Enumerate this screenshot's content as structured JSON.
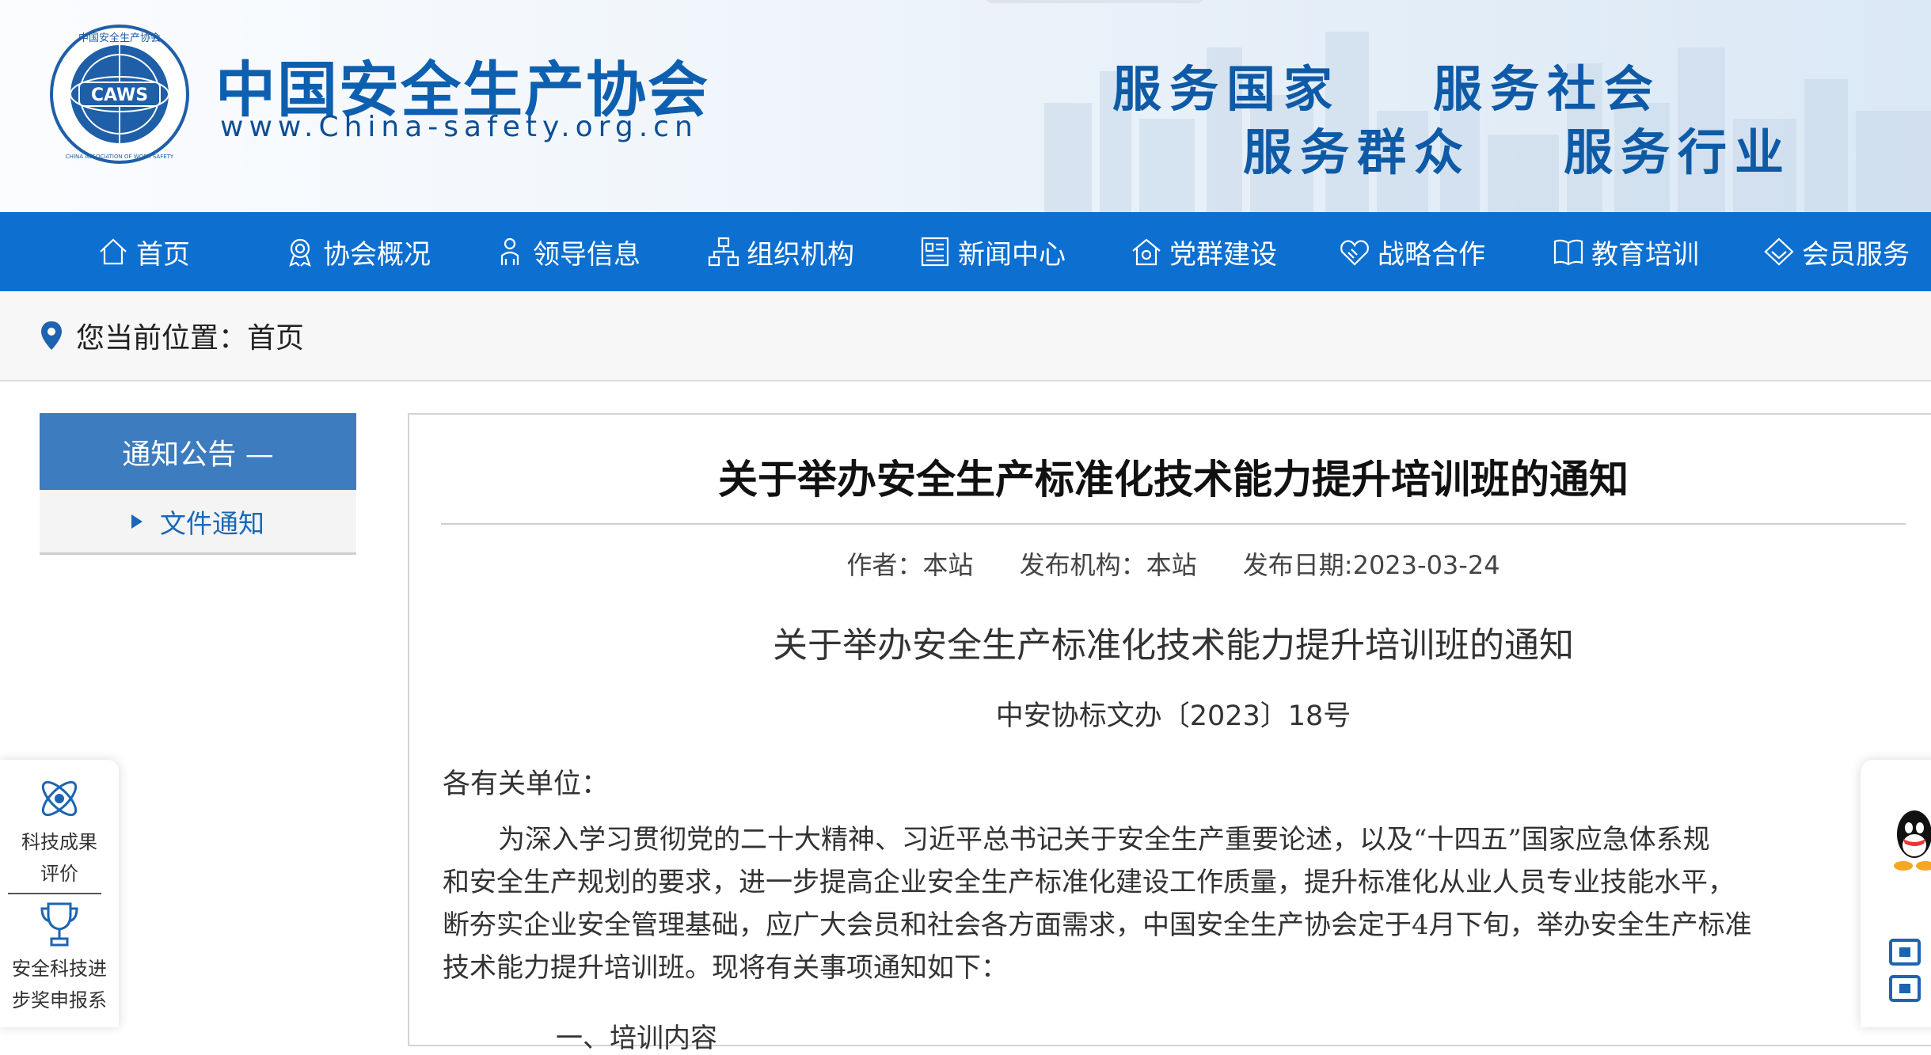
{
  "header": {
    "site_title": "中国安全生产协会",
    "site_url": "www.China-safety.org.cn",
    "logo_text": "CAWS",
    "logo_ring_top": "中国安全生产协会",
    "logo_ring_bottom": "CHINA ASSOCIATION OF WORK SAFETY",
    "slogans": [
      "服务国家",
      "服务社会",
      "服务群众",
      "服务行业"
    ]
  },
  "nav": {
    "items": [
      {
        "label": "首页",
        "icon": "home-icon"
      },
      {
        "label": "协会概况",
        "icon": "award-icon"
      },
      {
        "label": "领导信息",
        "icon": "people-icon"
      },
      {
        "label": "组织机构",
        "icon": "org-chart-icon"
      },
      {
        "label": "新闻中心",
        "icon": "newspaper-icon"
      },
      {
        "label": "党群建设",
        "icon": "building-icon"
      },
      {
        "label": "战略合作",
        "icon": "handshake-icon"
      },
      {
        "label": "教育培训",
        "icon": "book-icon"
      },
      {
        "label": "会员服务",
        "icon": "diamond-icon"
      }
    ]
  },
  "breadcrumb": {
    "prefix": "您当前位置：",
    "current": "首页",
    "icon": "location-pin-icon"
  },
  "sidebar": {
    "heading": "通知公告 —",
    "items": [
      {
        "label": "文件通知"
      }
    ]
  },
  "floating_left": {
    "items": [
      {
        "label_line1": "科技成果",
        "label_line2": "评价",
        "icon": "atom-icon"
      },
      {
        "label_line1": "安全科技进",
        "label_line2": "步奖申报系",
        "icon": "trophy-icon"
      }
    ]
  },
  "floating_right": {
    "items": [
      {
        "icon": "qq-icon"
      },
      {
        "icon": "qr-code-icon"
      }
    ]
  },
  "article": {
    "title": "关于举办安全生产标准化技术能力提升培训班的通知",
    "meta": {
      "author": "作者：本站",
      "publisher": "发布机构：本站",
      "date": "发布日期:2023-03-24"
    },
    "doc_title": "关于举办安全生产标准化技术能力提升培训班的通知",
    "doc_number": "中安协标文办〔2023〕18号",
    "salutation": "各有关单位：",
    "paragraph_lines": [
      "为深入学习贯彻党的二十大精神、习近平总书记关于安全生产重要论述，以及“十四五”国家应急体系规",
      "和安全生产规划的要求，进一步提高企业安全生产标准化建设工作质量，提升标准化从业人员专业技能水平，",
      "断夯实企业安全管理基础，应广大会员和社会各方面需求，中国安全生产协会定于4月下旬，举办安全生产标准",
      "技术能力提升培训班。现将有关事项通知如下："
    ],
    "next_heading_partial": "一、培训内容"
  },
  "colors": {
    "nav_bg": "#0d6fd0",
    "title_blue": "#0d5fb0",
    "sidebar_head": "#3e7cc0",
    "link_blue": "#1a67b8"
  }
}
